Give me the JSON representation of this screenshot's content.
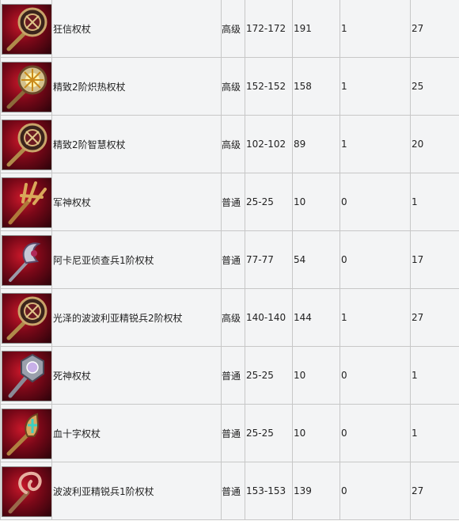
{
  "rows": [
    {
      "icon": "wooden-staff-icon",
      "name": "狂信权杖",
      "grade": "高级",
      "damage": "172-172",
      "v1": "191",
      "v2": "1",
      "v3": "27"
    },
    {
      "icon": "sun-staff-icon",
      "name": "精致2阶炽热权杖",
      "grade": "高级",
      "damage": "152-152",
      "v1": "158",
      "v2": "1",
      "v3": "25"
    },
    {
      "icon": "wooden-staff-icon",
      "name": "精致2阶智慧权杖",
      "grade": "高级",
      "damage": "102-102",
      "v1": "89",
      "v2": "1",
      "v3": "20"
    },
    {
      "icon": "claw-staff-icon",
      "name": "军神权杖",
      "grade": "普通",
      "damage": "25-25",
      "v1": "10",
      "v2": "0",
      "v3": "1"
    },
    {
      "icon": "crescent-staff-icon",
      "name": "阿卡尼亚侦查兵1阶权杖",
      "grade": "普通",
      "damage": "77-77",
      "v1": "54",
      "v2": "0",
      "v3": "17"
    },
    {
      "icon": "wooden-staff-icon",
      "name": "光泽的波波利亚精锐兵2阶权杖",
      "grade": "高级",
      "damage": "140-140",
      "v1": "144",
      "v2": "1",
      "v3": "27"
    },
    {
      "icon": "silver-staff-icon",
      "name": "死神权杖",
      "grade": "普通",
      "damage": "25-25",
      "v1": "10",
      "v2": "0",
      "v3": "1"
    },
    {
      "icon": "cross-staff-icon",
      "name": "血十字权杖",
      "grade": "普通",
      "damage": "25-25",
      "v1": "10",
      "v2": "0",
      "v3": "1"
    },
    {
      "icon": "spiral-staff-icon",
      "name": "波波利亚精锐兵1阶权杖",
      "grade": "普通",
      "damage": "153-153",
      "v1": "139",
      "v2": "0",
      "v3": "27"
    }
  ],
  "colors": {
    "icon_bg": "#8b0a1c",
    "cell_bg": "#f3f4f5",
    "border": "#c7c7c7"
  }
}
